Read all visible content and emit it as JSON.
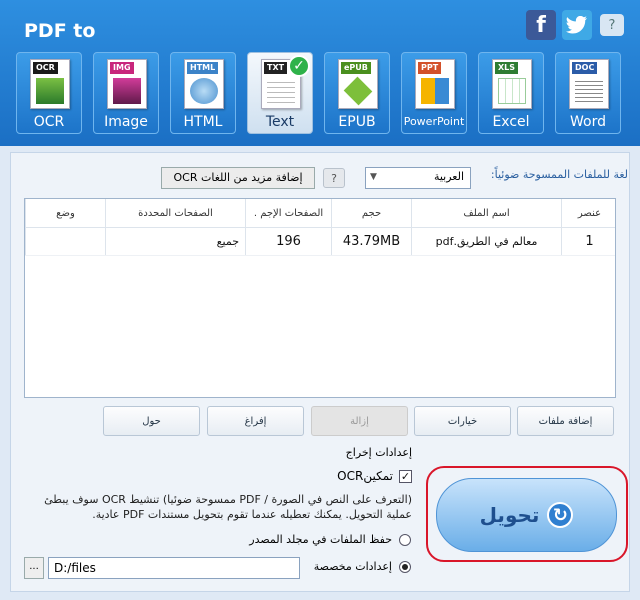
{
  "header": {
    "title": "PDF to",
    "social": {
      "facebook": "f",
      "help": "?"
    },
    "formats": [
      {
        "label": "OCR",
        "badge": "OCR",
        "badge_color": "#1a1a1a",
        "icon": "ocr-icon"
      },
      {
        "label": "Image",
        "badge": "IMG",
        "badge_color": "#c8267c",
        "icon": "image-icon"
      },
      {
        "label": "HTML",
        "badge": "HTML",
        "badge_color": "#3c83c8",
        "icon": "html-icon"
      },
      {
        "label": "Text",
        "badge": "TXT",
        "badge_color": "#222222",
        "icon": "text-icon",
        "active": true
      },
      {
        "label": "EPUB",
        "badge": "ePUB",
        "badge_color": "#4a8f1e",
        "icon": "epub-icon"
      },
      {
        "label": "PowerPoint",
        "badge": "PPT",
        "badge_color": "#d3512a",
        "icon": "powerpoint-icon"
      },
      {
        "label": "Excel",
        "badge": "XLS",
        "badge_color": "#2e7d32",
        "icon": "excel-icon"
      },
      {
        "label": "Word",
        "badge": "DOC",
        "badge_color": "#2b5ca8",
        "icon": "word-icon"
      }
    ],
    "checkmark": "✓"
  },
  "ocr": {
    "language_label": "لغة للملفات الممسوحة ضوئياً:",
    "language_value": "العربية",
    "help": "?",
    "more_languages_button": "إضافة مزيد من اللغات OCR"
  },
  "table": {
    "headers": [
      "عنصر",
      "اسم الملف",
      "حجم",
      "الصفحات الإجم .",
      "الصفحات المحددة",
      "وضع"
    ],
    "rows": [
      {
        "index": "1",
        "name": "معالم في الطريق.pdf",
        "size": "43.79MB",
        "total_pages": "196",
        "selected_pages": "جميع",
        "status": ""
      }
    ]
  },
  "actions": {
    "add_files": "إضافة ملفات",
    "options": "خيارات",
    "remove": "إزالة",
    "clear": "إفراغ",
    "about": "حول"
  },
  "output": {
    "title": "إعدادات إخراج",
    "enable_ocr": "تمكينOCR",
    "note": "(التعرف على النص في الصورة / PDF ممسوحة ضوئيا) تنشيط OCR سوف يبطئ عملية التحويل. يمكنك تعطيله عندما تقوم بتحويل مستندات PDF عادية.",
    "save_in_source": "حفظ الملفات في مجلد المصدر",
    "custom": "إعدادات مخصصة",
    "path": "D:/files",
    "browse": "..."
  },
  "convert": {
    "label": "تحويل"
  }
}
